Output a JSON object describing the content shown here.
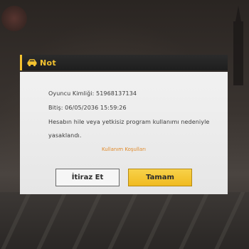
{
  "dialog": {
    "title": "Not",
    "icon": "car-icon",
    "player_id_line": "Oyuncu Kimliği: 51968137134",
    "end_date_line": "Bitiş: 06/05/2036 15:59:26",
    "message_line_1": "Hesabın hile veya yetkisiz program kullanımı nedeniyle",
    "message_line_2": "yasaklandı.",
    "terms_link": "Kullanım Koşulları",
    "appeal_button": "İtiraz Et",
    "ok_button": "Tamam"
  },
  "colors": {
    "accent": "#f2c230",
    "link": "#e08a2a",
    "header_bg": "#222222",
    "body_bg": "#eeeeee"
  }
}
